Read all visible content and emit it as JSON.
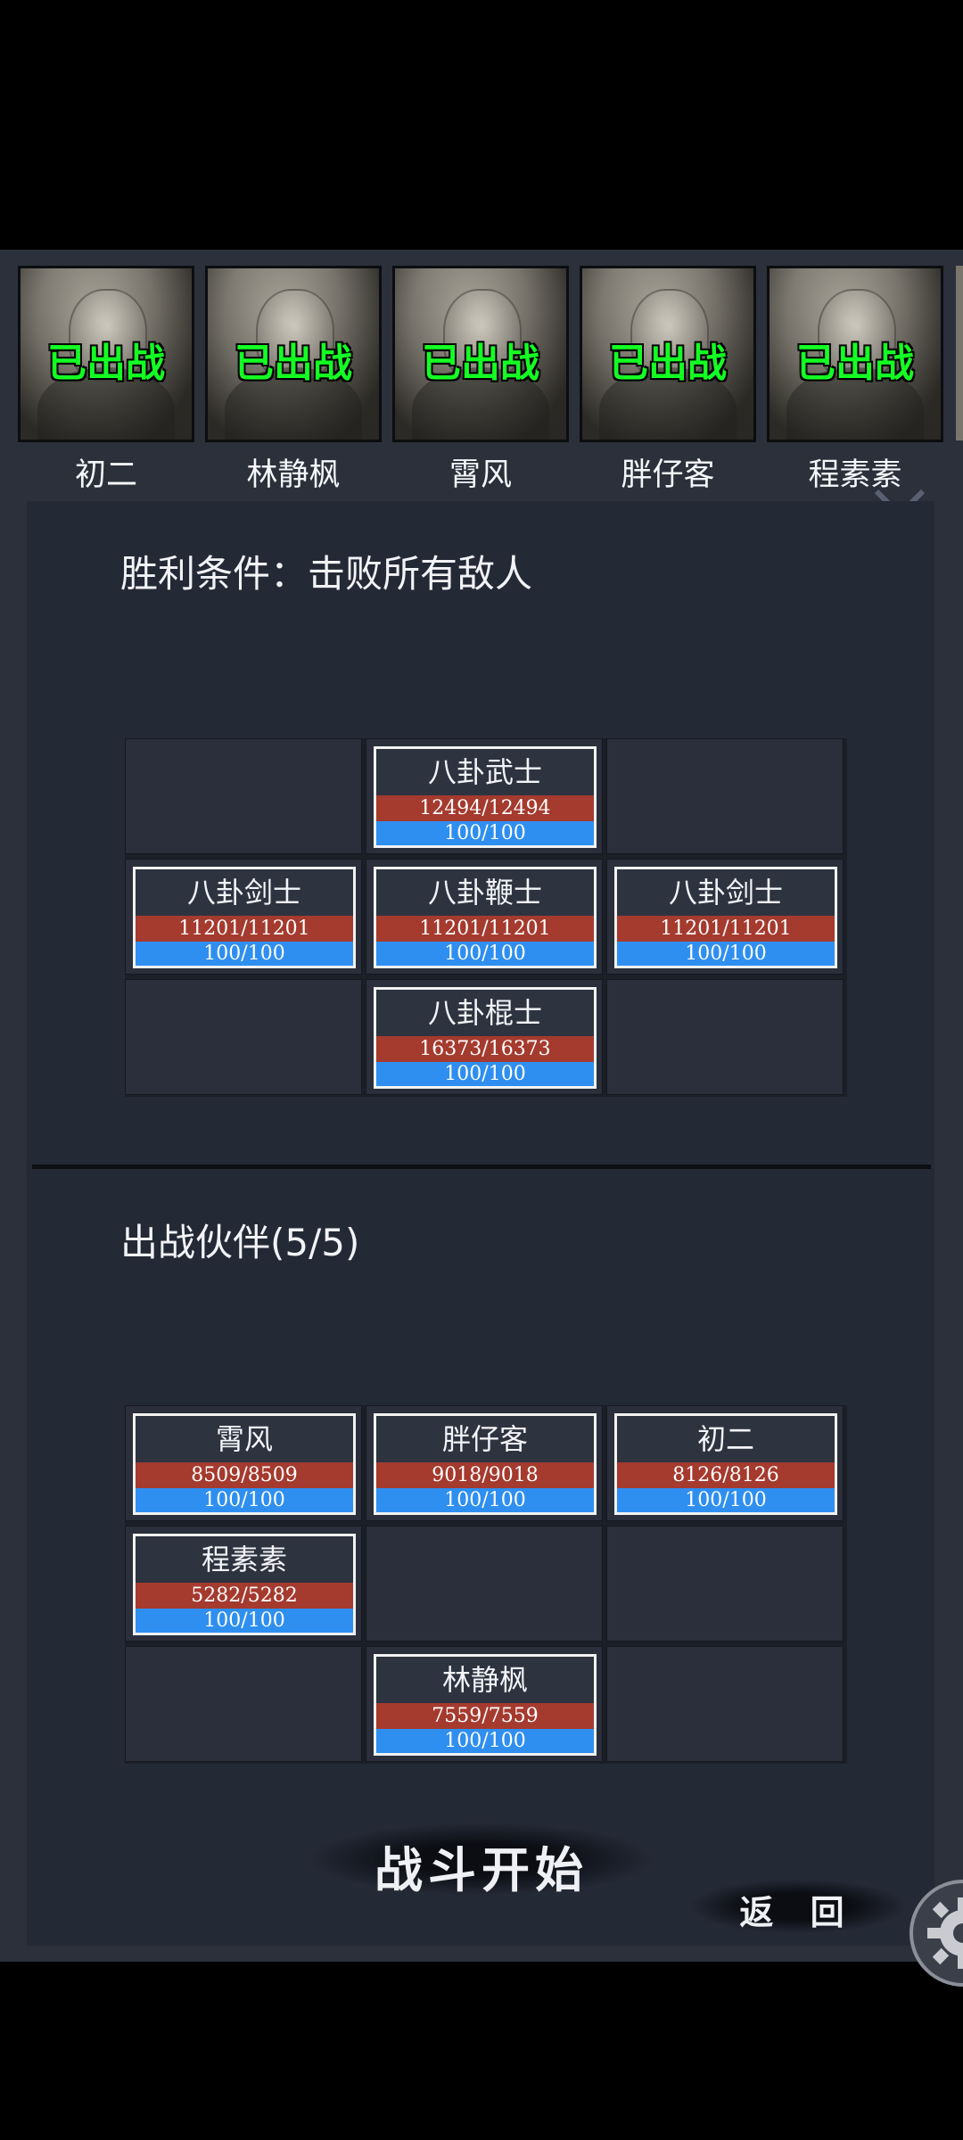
{
  "roster": [
    {
      "name": "初二",
      "status": "已出战"
    },
    {
      "name": "林静枫",
      "status": "已出战"
    },
    {
      "name": "霄风",
      "status": "已出战"
    },
    {
      "name": "胖仔客",
      "status": "已出战"
    },
    {
      "name": "程素素",
      "status": "已出战"
    }
  ],
  "victory_condition": "胜利条件：击败所有敌人",
  "enemies": {
    "top_center": {
      "name": "八卦武士",
      "hp": "12494/12494",
      "mp": "100/100"
    },
    "mid_left": {
      "name": "八卦剑士",
      "hp": "11201/11201",
      "mp": "100/100"
    },
    "mid_center": {
      "name": "八卦鞭士",
      "hp": "11201/11201",
      "mp": "100/100"
    },
    "mid_right": {
      "name": "八卦剑士",
      "hp": "11201/11201",
      "mp": "100/100"
    },
    "bottom_center": {
      "name": "八卦棍士",
      "hp": "16373/16373",
      "mp": "100/100"
    }
  },
  "party_title": "出战伙伴(5/5)",
  "party": {
    "top_left": {
      "name": "霄风",
      "hp": "8509/8509",
      "mp": "100/100"
    },
    "top_center": {
      "name": "胖仔客",
      "hp": "9018/9018",
      "mp": "100/100"
    },
    "top_right": {
      "name": "初二",
      "hp": "8126/8126",
      "mp": "100/100"
    },
    "mid_left": {
      "name": "程素素",
      "hp": "5282/5282",
      "mp": "100/100"
    },
    "bottom_center": {
      "name": "林静枫",
      "hp": "7559/7559",
      "mp": "100/100"
    }
  },
  "buttons": {
    "start": "战斗开始",
    "back": "返 回"
  },
  "colors": {
    "deployed": "#14ff23",
    "hp_bar": "#a53a2e",
    "mp_bar": "#2f8ff0",
    "panel": "#242936"
  },
  "icons": {
    "collapse": "chevron-down-icon",
    "settings": "gear-icon"
  }
}
